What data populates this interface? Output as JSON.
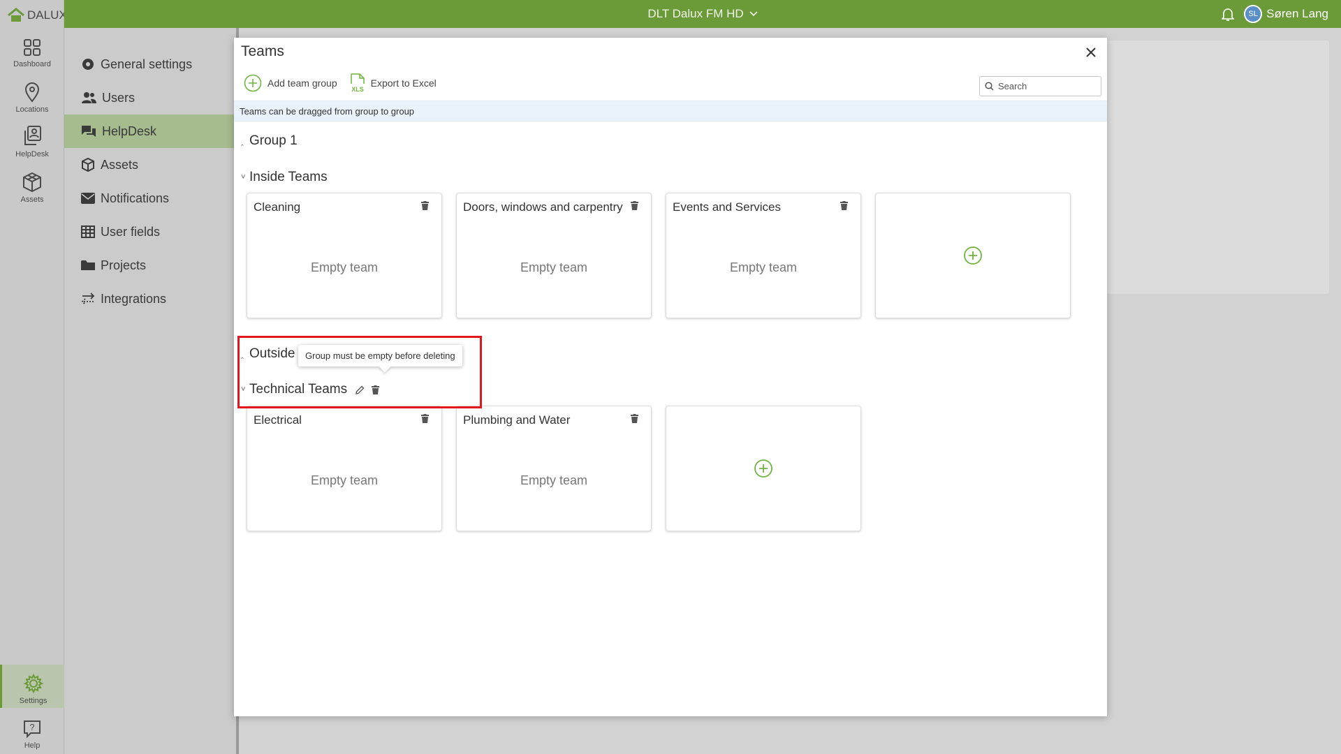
{
  "app": {
    "logo_text": "DALUX",
    "project_title": "DLT Dalux FM HD",
    "user_initials": "SL",
    "user_name": "Søren Lang"
  },
  "rail": {
    "items": [
      {
        "label": "Dashboard",
        "icon": "dashboard-grid-icon"
      },
      {
        "label": "Locations",
        "icon": "location-pin-icon"
      },
      {
        "label": "HelpDesk",
        "icon": "helpdesk-icon"
      },
      {
        "label": "Assets",
        "icon": "assets-cube-icon"
      }
    ],
    "settings_label": "Settings",
    "help_label": "Help"
  },
  "menu": {
    "items": [
      {
        "label": "General settings",
        "icon": "gear-icon"
      },
      {
        "label": "Users",
        "icon": "users-icon"
      },
      {
        "label": "HelpDesk",
        "icon": "chat-icon",
        "active": true
      },
      {
        "label": "Assets",
        "icon": "cube-icon"
      },
      {
        "label": "Notifications",
        "icon": "envelope-icon"
      },
      {
        "label": "User fields",
        "icon": "table-icon"
      },
      {
        "label": "Projects",
        "icon": "folder-icon"
      },
      {
        "label": "Integrations",
        "icon": "arrows-icon"
      }
    ]
  },
  "modal": {
    "title": "Teams",
    "add_group_label": "Add team group",
    "export_label": "Export to Excel",
    "search_placeholder": "Search",
    "info_text": "Teams can be dragged from group to group",
    "groups": [
      {
        "name": "Group 1",
        "collapsed": true
      },
      {
        "name": "Inside Teams",
        "collapsed": false,
        "teams": [
          {
            "name": "Cleaning",
            "status": "Empty team"
          },
          {
            "name": "Doors, windows and carpentry",
            "status": "Empty team"
          },
          {
            "name": "Events and Services",
            "status": "Empty team"
          }
        ]
      },
      {
        "name": "Outside",
        "collapsed": true
      },
      {
        "name": "Technical Teams",
        "collapsed": false,
        "teams": [
          {
            "name": "Electrical",
            "status": "Empty team"
          },
          {
            "name": "Plumbing and Water",
            "status": "Empty team"
          }
        ]
      }
    ],
    "tooltip": "Group must be empty before deleting"
  },
  "colors": {
    "brand_green": "#6b9a38",
    "highlight_red": "#e0181e"
  }
}
